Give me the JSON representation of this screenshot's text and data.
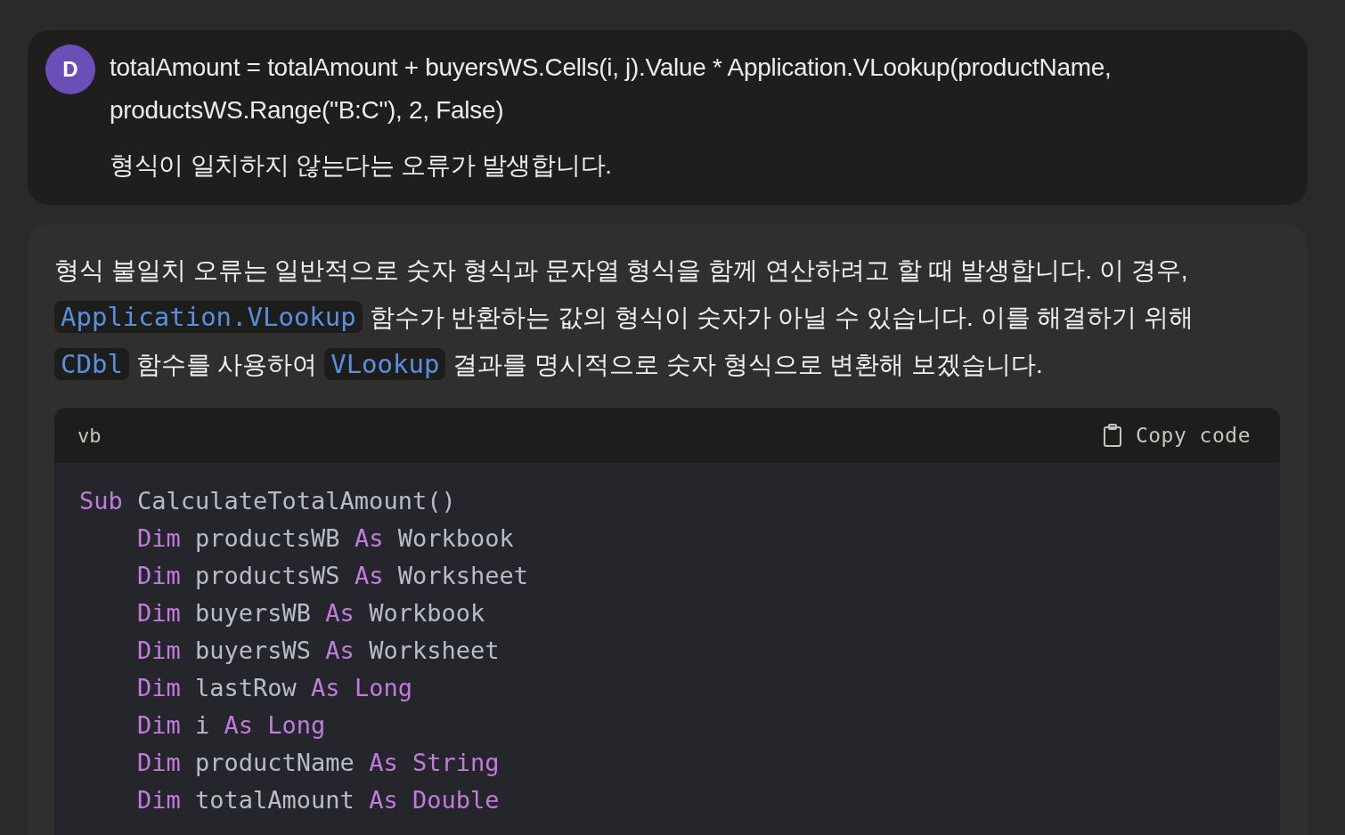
{
  "user_message": {
    "avatar": "D",
    "paragraphs": [
      "totalAmount = totalAmount + buyersWS.Cells(i, j).Value * Application.VLookup(productName, productsWS.Range(\"B:C\"), 2, False)",
      "형식이 일치하지 않는다는 오류가 발생합니다."
    ]
  },
  "assistant_message": {
    "paragraphs": [
      {
        "segments": [
          {
            "kind": "text",
            "text": "형식 불일치 오류는 일반적으로 숫자 형식과 문자열 형식을 함께 연산하려고 할 때 발생합니다. 이 경우, "
          },
          {
            "kind": "code",
            "text": "Application.VLookup"
          },
          {
            "kind": "text",
            "text": " 함수가 반환하는 값의 형식이 숫자가 아닐 수 있습니다. 이를 해결하기 위해 "
          },
          {
            "kind": "code",
            "text": "CDbl"
          },
          {
            "kind": "text",
            "text": " 함수를 사용하여 "
          },
          {
            "kind": "code",
            "text": "VLookup"
          },
          {
            "kind": "text",
            "text": " 결과를 명시적으로 숫자 형식으로 변환해 보겠습니다."
          }
        ]
      }
    ]
  },
  "code_block": {
    "language": "vb",
    "copy_button": "Copy code",
    "lines": [
      {
        "tokens": [
          {
            "kind": "keyword",
            "text": "Sub"
          },
          {
            "kind": "plain",
            "text": " CalculateTotalAmount()"
          }
        ],
        "children": [
          {
            "tokens": [
              {
                "kind": "keyword",
                "text": "Dim"
              },
              {
                "kind": "plain",
                "text": " productsWB "
              },
              {
                "kind": "keyword",
                "text": "As"
              },
              {
                "kind": "plain",
                "text": " Workbook"
              }
            ]
          },
          {
            "tokens": [
              {
                "kind": "keyword",
                "text": "Dim"
              },
              {
                "kind": "plain",
                "text": " productsWS "
              },
              {
                "kind": "keyword",
                "text": "As"
              },
              {
                "kind": "plain",
                "text": " Worksheet"
              }
            ]
          },
          {
            "tokens": [
              {
                "kind": "keyword",
                "text": "Dim"
              },
              {
                "kind": "plain",
                "text": " buyersWB "
              },
              {
                "kind": "keyword",
                "text": "As"
              },
              {
                "kind": "plain",
                "text": " Workbook"
              }
            ]
          },
          {
            "tokens": [
              {
                "kind": "keyword",
                "text": "Dim"
              },
              {
                "kind": "plain",
                "text": " buyersWS "
              },
              {
                "kind": "keyword",
                "text": "As"
              },
              {
                "kind": "plain",
                "text": " Worksheet"
              }
            ]
          },
          {
            "tokens": [
              {
                "kind": "keyword",
                "text": "Dim"
              },
              {
                "kind": "plain",
                "text": " lastRow "
              },
              {
                "kind": "keyword",
                "text": "As Long"
              }
            ]
          },
          {
            "tokens": [
              {
                "kind": "keyword",
                "text": "Dim"
              },
              {
                "kind": "plain",
                "text": " i "
              },
              {
                "kind": "keyword",
                "text": "As Long"
              }
            ]
          },
          {
            "tokens": [
              {
                "kind": "keyword",
                "text": "Dim"
              },
              {
                "kind": "plain",
                "text": " productName "
              },
              {
                "kind": "keyword",
                "text": "As String"
              }
            ]
          },
          {
            "tokens": [
              {
                "kind": "keyword",
                "text": "Dim"
              },
              {
                "kind": "plain",
                "text": " totalAmount "
              },
              {
                "kind": "keyword",
                "text": "As Double"
              }
            ]
          }
        ]
      }
    ]
  }
}
